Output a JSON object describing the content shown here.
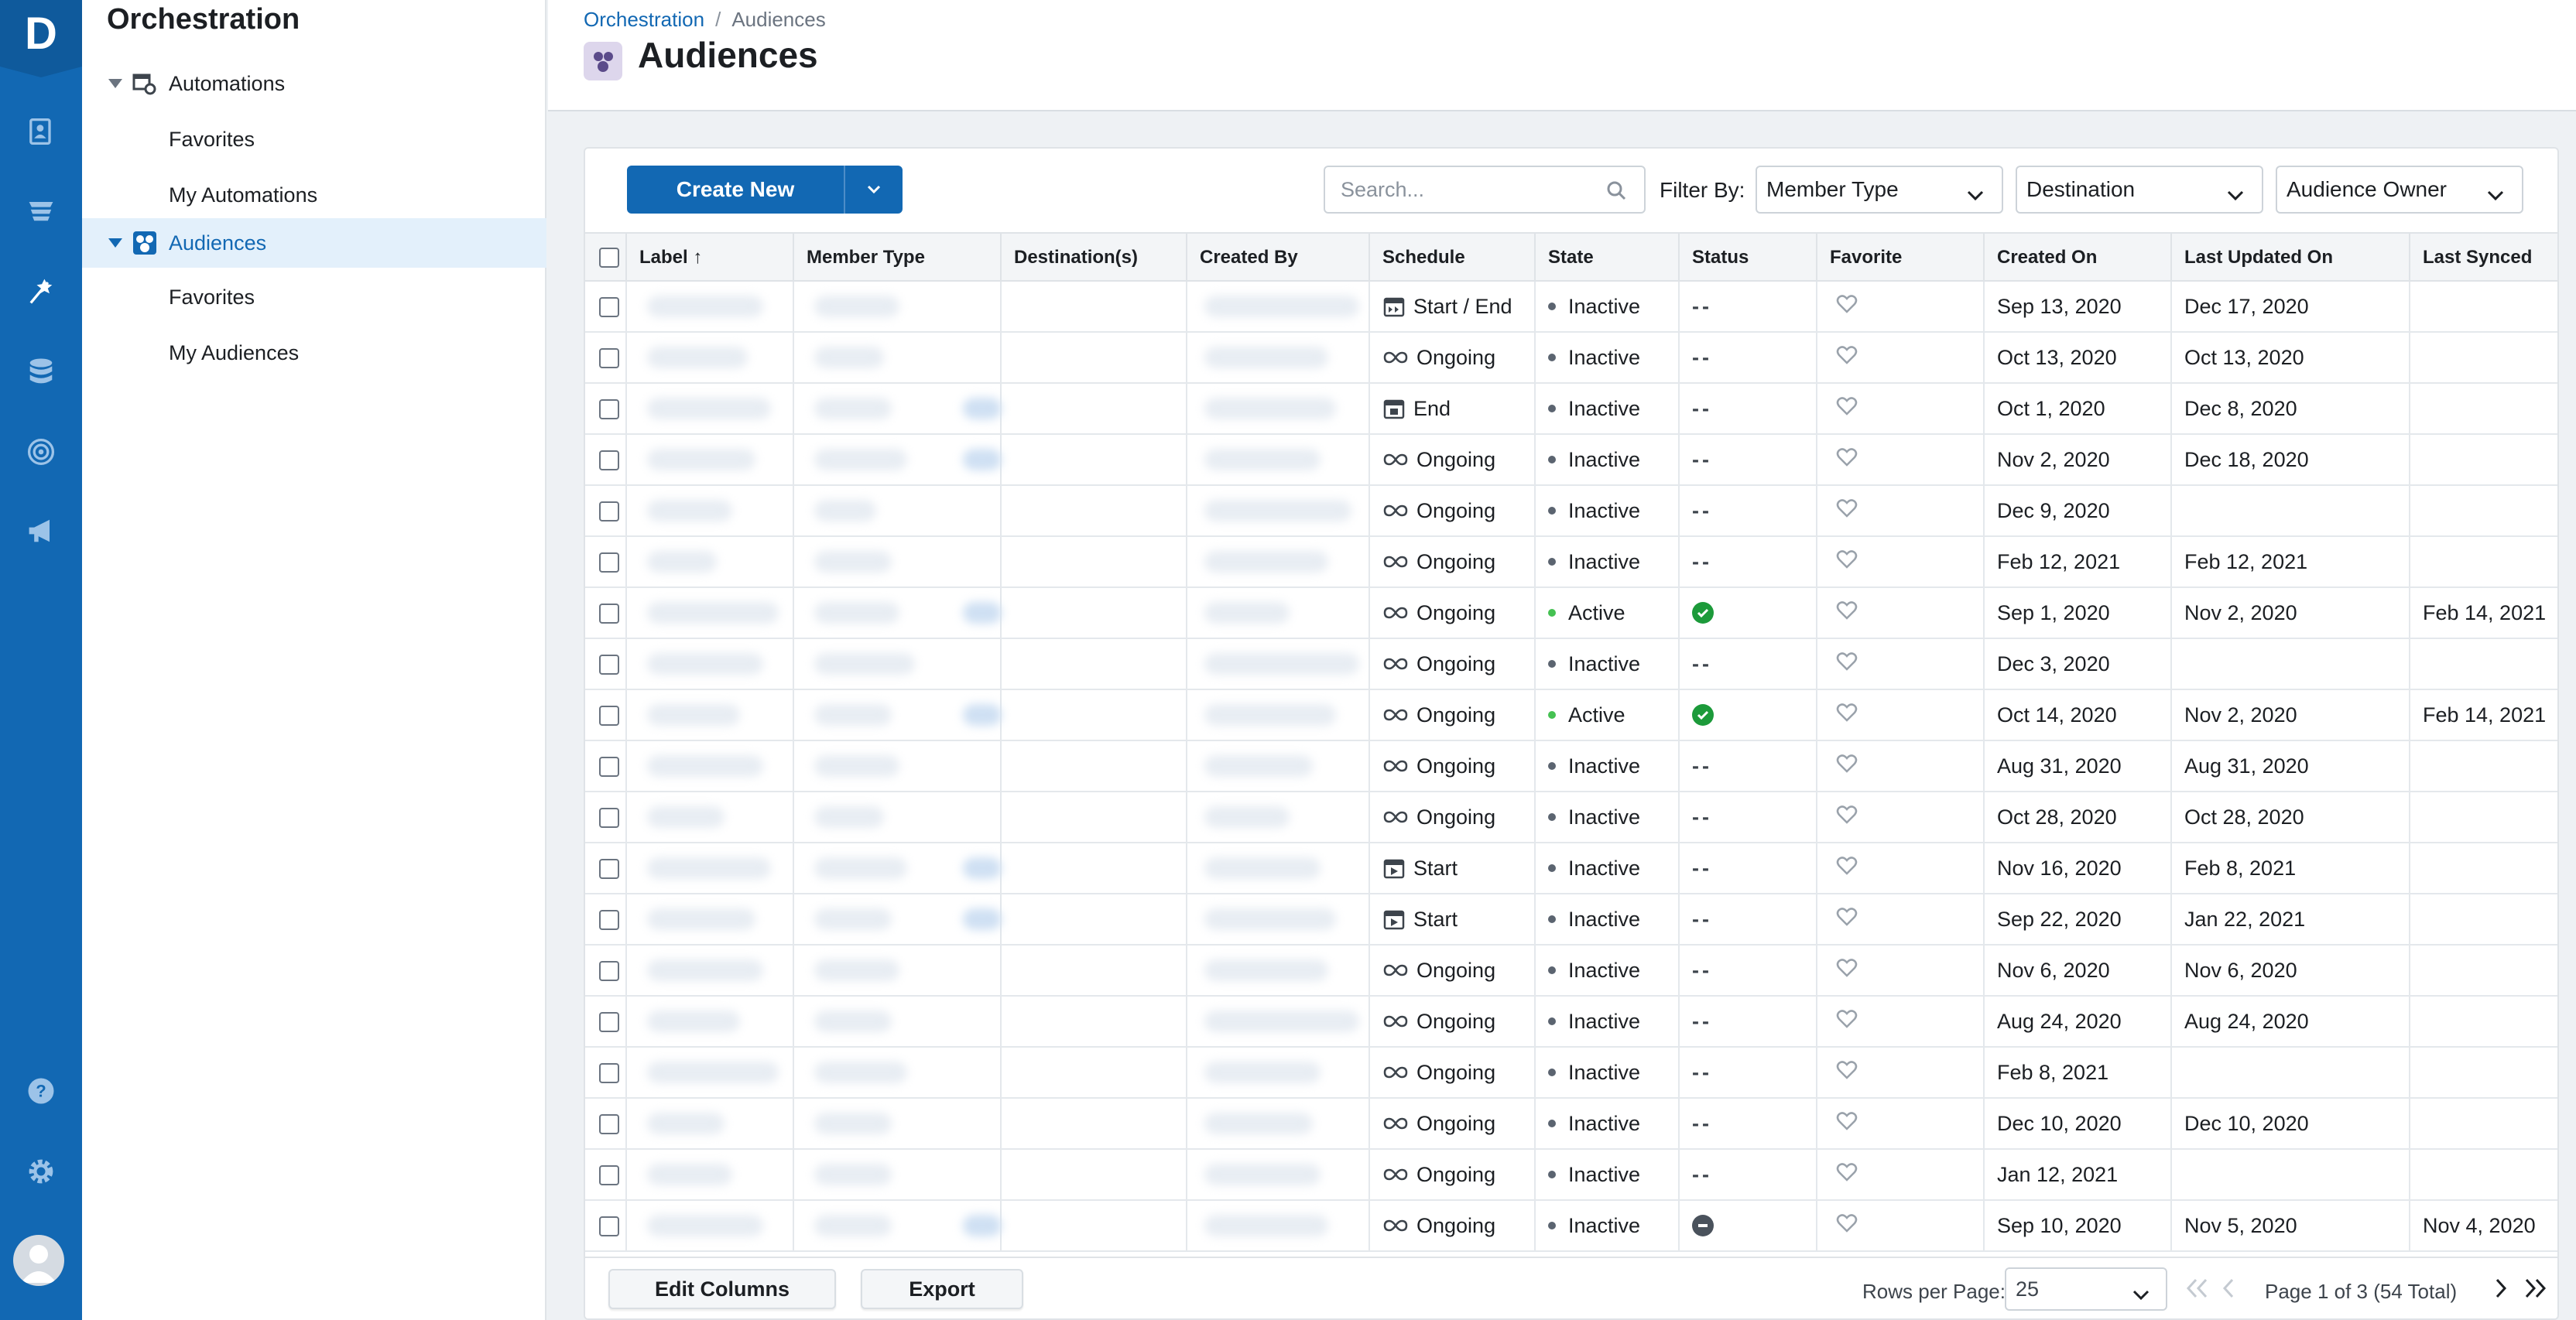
{
  "rail": {
    "logo": "D",
    "icons": [
      "contacts-icon",
      "database-stack-icon",
      "orchestration-icon",
      "storage-icon",
      "target-icon",
      "megaphone-icon",
      "help-icon",
      "settings-icon",
      "user-avatar"
    ]
  },
  "nav": {
    "title": "Orchestration",
    "automations": "Automations",
    "automations_favorites": "Favorites",
    "my_automations": "My Automations",
    "audiences": "Audiences",
    "audiences_favorites": "Favorites",
    "my_audiences": "My Audiences"
  },
  "header": {
    "breadcrumb_root": "Orchestration",
    "breadcrumb_sep": "/",
    "breadcrumb_current": "Audiences",
    "title": "Audiences"
  },
  "toolbar": {
    "create_label": "Create New",
    "search_placeholder": "Search...",
    "filter_label": "Filter By:",
    "filter_member_type": "Member Type",
    "filter_destination": "Destination",
    "filter_owner": "Audience Owner"
  },
  "table": {
    "columns": [
      "Label",
      "Member Type",
      "Destination(s)",
      "Created By",
      "Schedule",
      "State",
      "Status",
      "Favorite",
      "Created On",
      "Last Updated On",
      "Last Synced"
    ],
    "sort_indicator": "↑",
    "rows": [
      {
        "schedule": "Start / End",
        "sched_icon": "calendar-start-end",
        "state": "Inactive",
        "status": "--",
        "created": "Sep 13, 2020",
        "updated": "Dec 17, 2020",
        "synced": ""
      },
      {
        "schedule": "Ongoing",
        "sched_icon": "infinity",
        "state": "Inactive",
        "status": "--",
        "created": "Oct 13, 2020",
        "updated": "Oct 13, 2020",
        "synced": ""
      },
      {
        "schedule": "End",
        "sched_icon": "calendar-end",
        "state": "Inactive",
        "status": "--",
        "created": "Oct 1, 2020",
        "updated": "Dec 8, 2020",
        "synced": ""
      },
      {
        "schedule": "Ongoing",
        "sched_icon": "infinity",
        "state": "Inactive",
        "status": "--",
        "created": "Nov 2, 2020",
        "updated": "Dec 18, 2020",
        "synced": ""
      },
      {
        "schedule": "Ongoing",
        "sched_icon": "infinity",
        "state": "Inactive",
        "status": "--",
        "created": "Dec 9, 2020",
        "updated": "",
        "synced": ""
      },
      {
        "schedule": "Ongoing",
        "sched_icon": "infinity",
        "state": "Inactive",
        "status": "--",
        "created": "Feb 12, 2021",
        "updated": "Feb 12, 2021",
        "synced": ""
      },
      {
        "schedule": "Ongoing",
        "sched_icon": "infinity",
        "state": "Active",
        "status": "ok",
        "created": "Sep 1, 2020",
        "updated": "Nov 2, 2020",
        "synced": "Feb 14, 2021"
      },
      {
        "schedule": "Ongoing",
        "sched_icon": "infinity",
        "state": "Inactive",
        "status": "--",
        "created": "Dec 3, 2020",
        "updated": "",
        "synced": ""
      },
      {
        "schedule": "Ongoing",
        "sched_icon": "infinity",
        "state": "Active",
        "status": "ok",
        "created": "Oct 14, 2020",
        "updated": "Nov 2, 2020",
        "synced": "Feb 14, 2021"
      },
      {
        "schedule": "Ongoing",
        "sched_icon": "infinity",
        "state": "Inactive",
        "status": "--",
        "created": "Aug 31, 2020",
        "updated": "Aug 31, 2020",
        "synced": ""
      },
      {
        "schedule": "Ongoing",
        "sched_icon": "infinity",
        "state": "Inactive",
        "status": "--",
        "created": "Oct 28, 2020",
        "updated": "Oct 28, 2020",
        "synced": ""
      },
      {
        "schedule": "Start",
        "sched_icon": "calendar-start",
        "state": "Inactive",
        "status": "--",
        "created": "Nov 16, 2020",
        "updated": "Feb 8, 2021",
        "synced": ""
      },
      {
        "schedule": "Start",
        "sched_icon": "calendar-start",
        "state": "Inactive",
        "status": "--",
        "created": "Sep 22, 2020",
        "updated": "Jan 22, 2021",
        "synced": ""
      },
      {
        "schedule": "Ongoing",
        "sched_icon": "infinity",
        "state": "Inactive",
        "status": "--",
        "created": "Nov 6, 2020",
        "updated": "Nov 6, 2020",
        "synced": ""
      },
      {
        "schedule": "Ongoing",
        "sched_icon": "infinity",
        "state": "Inactive",
        "status": "--",
        "created": "Aug 24, 2020",
        "updated": "Aug 24, 2020",
        "synced": ""
      },
      {
        "schedule": "Ongoing",
        "sched_icon": "infinity",
        "state": "Inactive",
        "status": "--",
        "created": "Feb 8, 2021",
        "updated": "",
        "synced": ""
      },
      {
        "schedule": "Ongoing",
        "sched_icon": "infinity",
        "state": "Inactive",
        "status": "--",
        "created": "Dec 10, 2020",
        "updated": "Dec 10, 2020",
        "synced": ""
      },
      {
        "schedule": "Ongoing",
        "sched_icon": "infinity",
        "state": "Inactive",
        "status": "--",
        "created": "Jan 12, 2021",
        "updated": "",
        "synced": ""
      },
      {
        "schedule": "Ongoing",
        "sched_icon": "infinity",
        "state": "Inactive",
        "status": "blocked",
        "created": "Sep 10, 2020",
        "updated": "Nov 5, 2020",
        "synced": "Nov 4, 2020"
      }
    ]
  },
  "footer": {
    "edit_columns": "Edit Columns",
    "export": "Export",
    "rows_per_page_label": "Rows per Page:",
    "rows_per_page": "25",
    "page_info": "Page 1 of 3 (54 Total)"
  },
  "colors": {
    "brand": "#1268b3",
    "active_dot": "#45c152",
    "status_ok": "#1c9a3a"
  }
}
